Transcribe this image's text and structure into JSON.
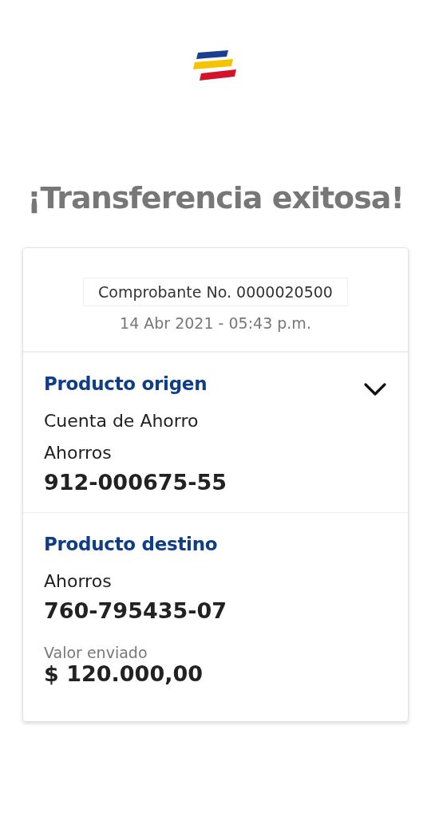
{
  "title": "¡Transferencia exitosa!",
  "receipt": {
    "number": "Comprobante No. 0000020500",
    "date": "14 Abr 2021 - 05:43 p.m."
  },
  "origin": {
    "heading": "Producto origen",
    "expanded": true,
    "lines": [
      "Cuenta de Ahorro",
      "Ahorros"
    ],
    "account": "912-000675-55"
  },
  "destination": {
    "heading": "Producto destino",
    "lines": [
      "Ahorros"
    ],
    "account": "760-795435-07",
    "amount_label": "Valor enviado",
    "amount": "$ 120.000,00"
  }
}
